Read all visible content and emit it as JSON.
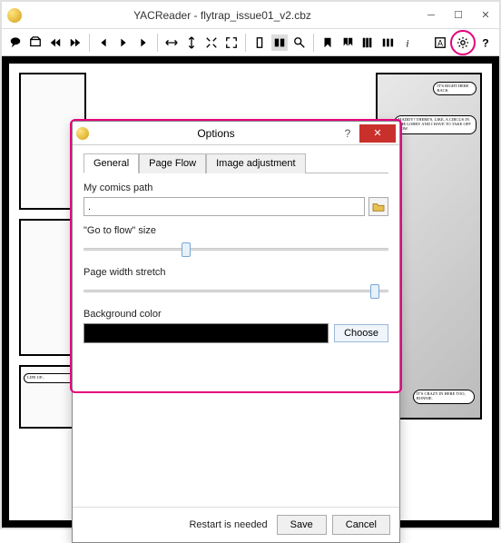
{
  "window": {
    "title": "YACReader - flytrap_issue01_v2.cbz"
  },
  "toolbar": {
    "icons": [
      "speech",
      "open",
      "rewind",
      "fast-forward",
      "prev",
      "play",
      "next",
      "fit-width",
      "fit-height",
      "fit-page",
      "fullscreen",
      "single-page",
      "double-page-active",
      "search",
      "bookmark",
      "bookmarks-list",
      "library",
      "rotate",
      "info"
    ],
    "right_icons": [
      "text-box",
      "settings",
      "help"
    ]
  },
  "comic": {
    "bubble1": "IT'S RIGHT HERE BACK",
    "bubble2": "MADDY? THERE'S, LIKE, A CIRCUS IN THE LOBBY AND I HAVE TO TAKE OFF NOW.",
    "bubble3": "IT'S CRAZY IN HERE TOO, BONNIE.",
    "bubble4": "LIFE UP..."
  },
  "dialog": {
    "title": "Options",
    "tabs": {
      "general": "General",
      "pageflow": "Page Flow",
      "imageadj": "Image adjustment"
    },
    "general": {
      "comics_path_label": "My comics path",
      "comics_path_value": ".",
      "goto_flow_label": "\"Go to flow\" size",
      "page_width_label": "Page width stretch",
      "bg_color_label": "Background color",
      "bg_color": "#000000",
      "choose_label": "Choose"
    },
    "footer": {
      "restart_text": "Restart is needed",
      "save": "Save",
      "cancel": "Cancel"
    }
  }
}
